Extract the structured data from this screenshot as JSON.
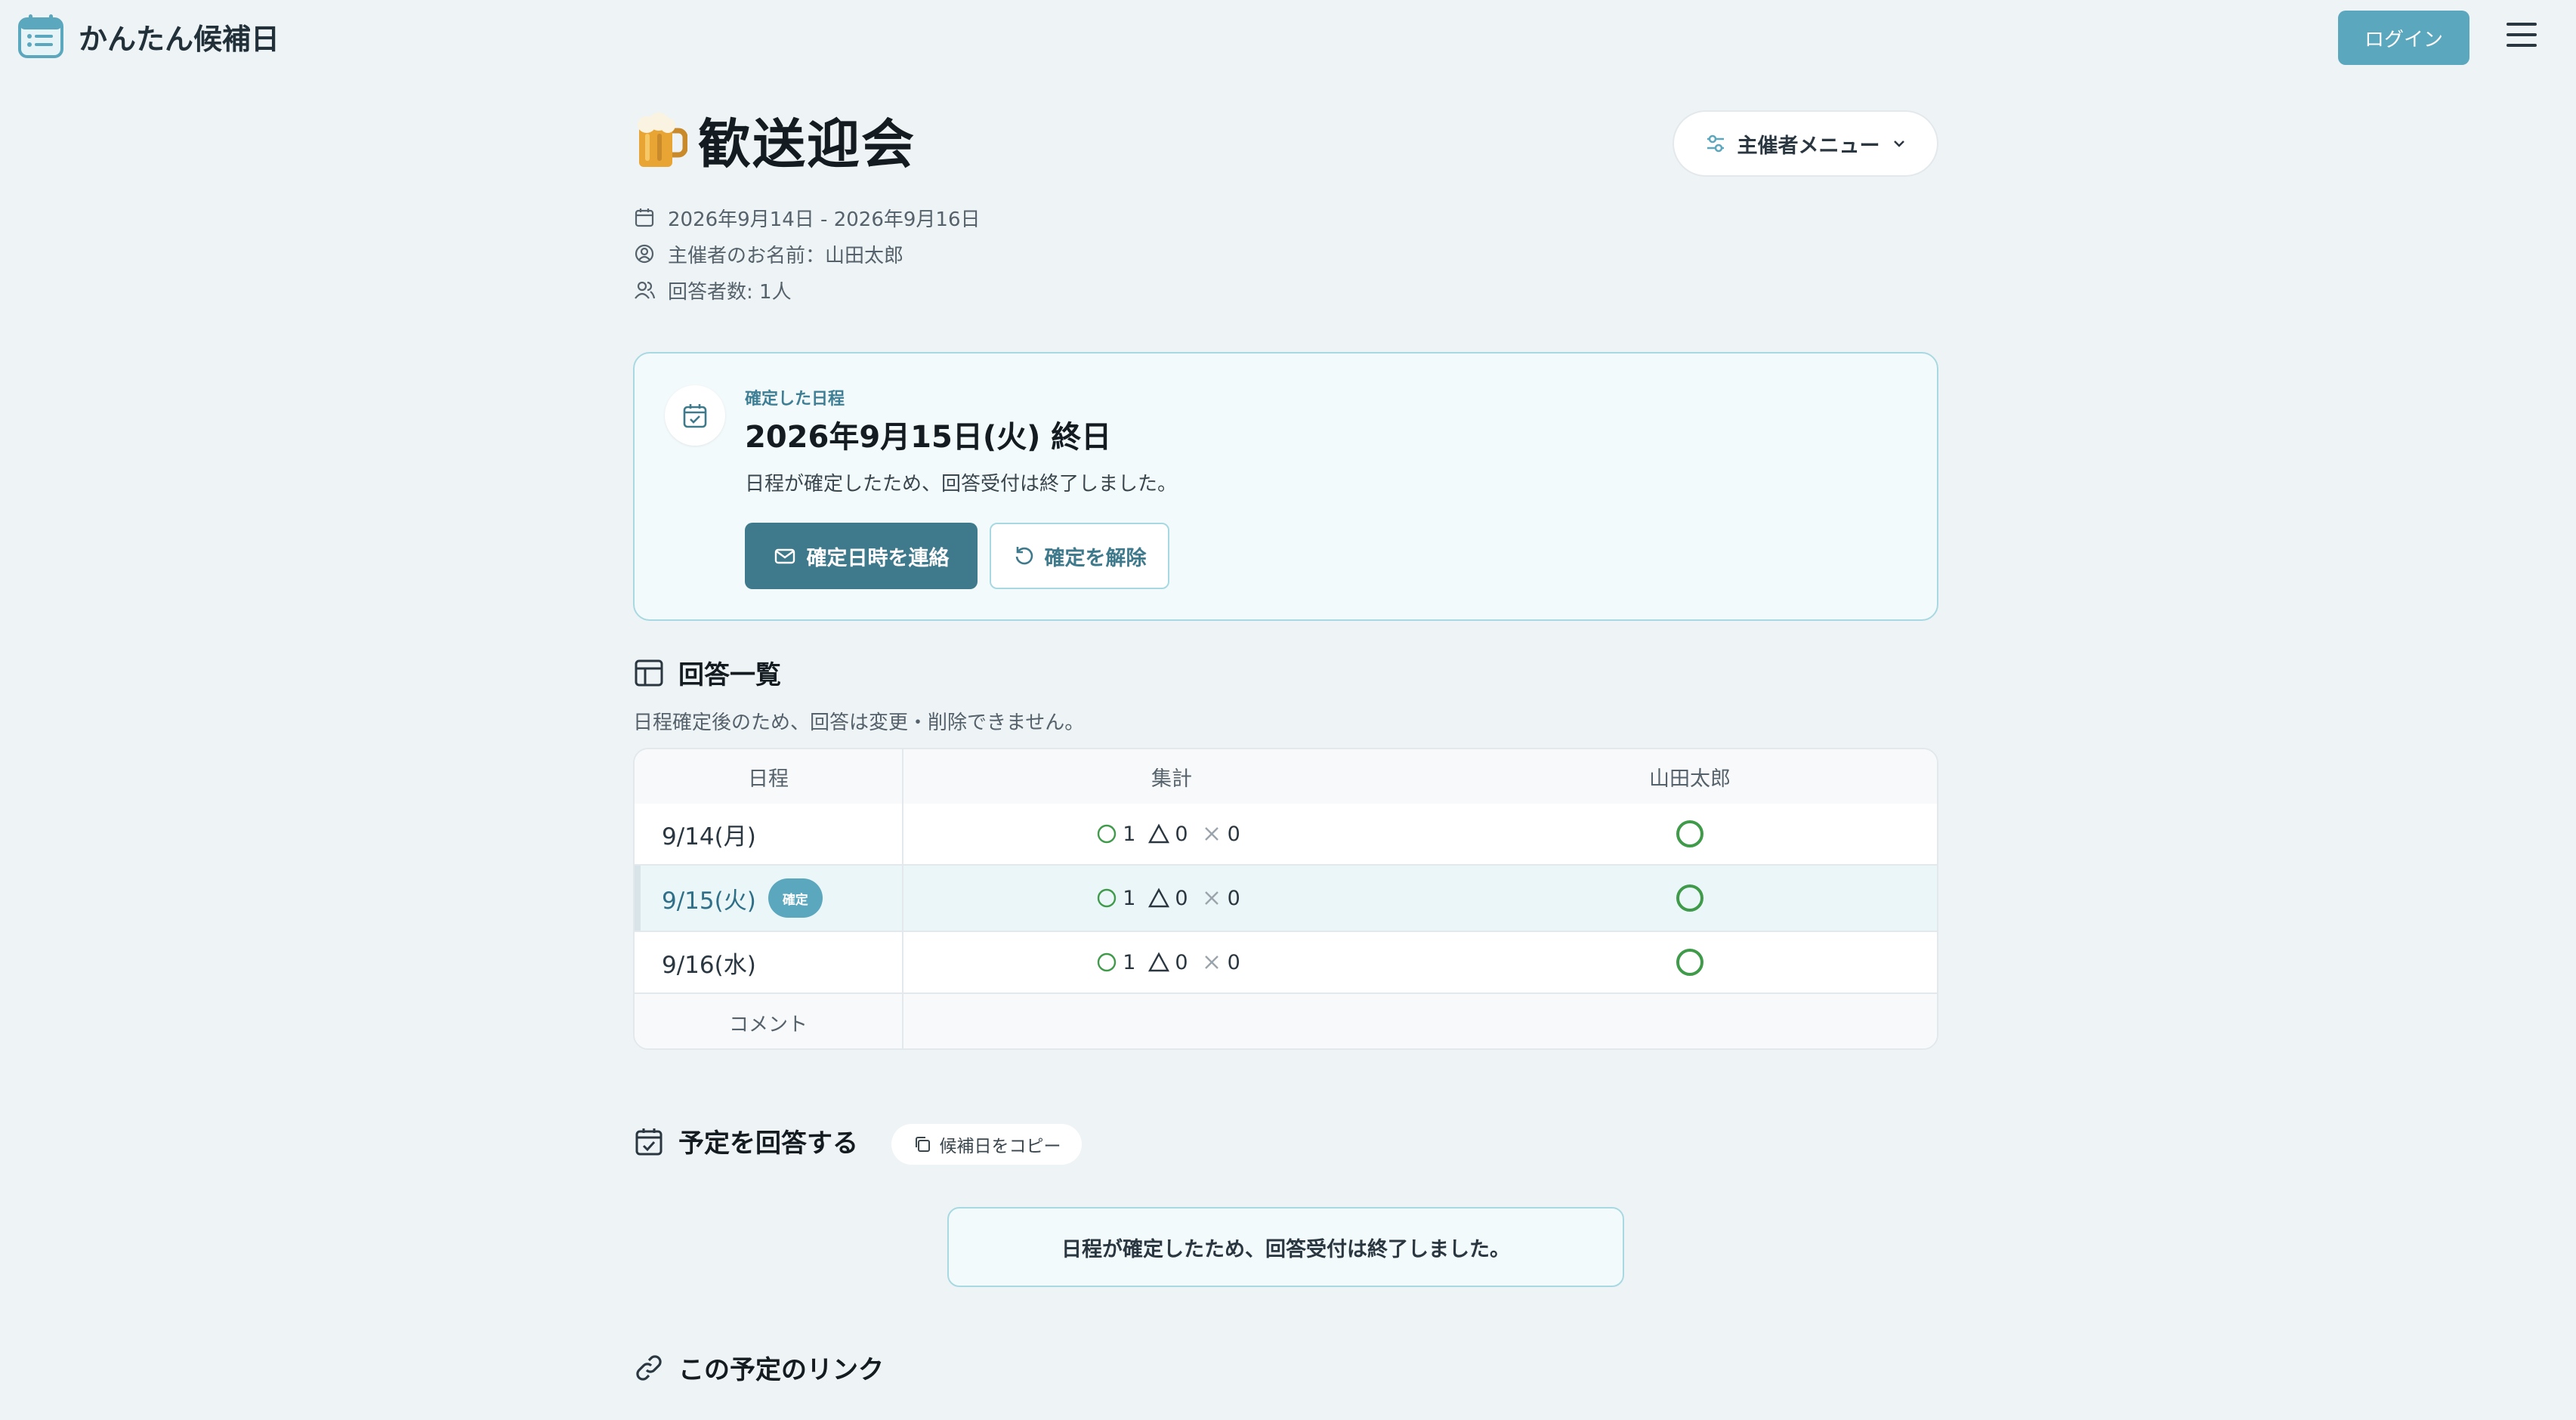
{
  "header": {
    "app_name": "かんたん候補日",
    "login_label": "ログイン"
  },
  "event": {
    "title": "歓送迎会",
    "organizer_menu_label": "主催者メニュー",
    "date_range": "2026年9月14日 - 2026年9月16日",
    "organizer": "主催者のお名前：山田太郎",
    "respondents": "回答者数: 1人"
  },
  "confirmed": {
    "label": "確定した日程",
    "date": "2026年9月15日(火) 終日",
    "note": "日程が確定したため、回答受付は終了しました。",
    "notify_label": "確定日時を連絡",
    "unconfirm_label": "確定を解除"
  },
  "answers": {
    "title": "回答一覧",
    "note": "日程確定後のため、回答は変更・削除できません。",
    "columns": [
      "日程",
      "集計",
      "山田太郎"
    ],
    "rows": [
      {
        "date": "9/14(月)",
        "ok": "1",
        "maybe": "0",
        "ng": "0",
        "answer": "ok"
      },
      {
        "date": "9/15(火)",
        "badge": "確定",
        "ok": "1",
        "maybe": "0",
        "ng": "0",
        "answer": "ok"
      },
      {
        "date": "9/16(水)",
        "ok": "1",
        "maybe": "0",
        "ng": "0",
        "answer": "ok"
      }
    ],
    "comment_label": "コメント"
  },
  "respond": {
    "title": "予定を回答する",
    "copy_label": "候補日をコピー",
    "closed_message": "日程が確定したため、回答受付は終了しました。"
  },
  "link_section": {
    "title": "この予定のリンク"
  },
  "icons": {
    "brand": "calendar-list-icon",
    "event": "beer-mug-icon",
    "menu": "hamburger-icon"
  },
  "colors": {
    "accent": "#5ba7bd",
    "primary_button": "#3f7a8c",
    "ok_green": "#3f9a4a",
    "background": "#eef3f5"
  }
}
